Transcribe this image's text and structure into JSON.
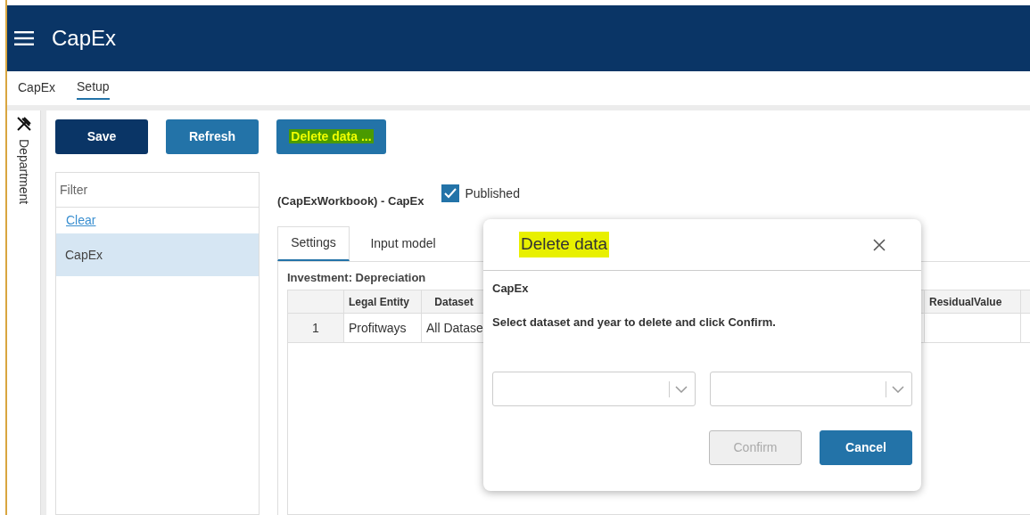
{
  "app": {
    "title": "CapEx"
  },
  "nav": [
    {
      "label": "CapEx",
      "selected": false
    },
    {
      "label": "Setup",
      "selected": true
    }
  ],
  "side_panel": {
    "label": "Department"
  },
  "toolbar": [
    {
      "label": "Save",
      "kind": "primary",
      "highlighted": false
    },
    {
      "label": "Refresh",
      "kind": "secondary",
      "highlighted": false
    },
    {
      "label": "Delete data ...",
      "kind": "secondary",
      "highlighted": true
    }
  ],
  "filter": {
    "placeholder": "Filter",
    "clear": "Clear",
    "items": [
      {
        "label": "CapEx",
        "selected": true
      }
    ]
  },
  "heading": "(CapExWorkbook) - CapEx",
  "published": {
    "label": "Published",
    "checked": true
  },
  "tabs": [
    {
      "label": "Settings",
      "selected": true
    },
    {
      "label": "Input model",
      "selected": false
    }
  ],
  "grid": {
    "title": "Investment: Depreciation",
    "columns": [
      {
        "label": "Legal Entity"
      },
      {
        "label": "Dataset"
      },
      {
        "label": "ResidualValue"
      }
    ],
    "rows": [
      {
        "number": "1",
        "cells": [
          "Profitways",
          "All Datase"
        ]
      }
    ]
  },
  "dialog": {
    "title": "Delete data",
    "title_highlighted": true,
    "subtitle": "CapEx",
    "message": "Select dataset and year to delete and click Confirm.",
    "dropdowns": [
      {
        "expanded": false
      },
      {
        "expanded": false
      }
    ],
    "buttons": [
      {
        "label": "Confirm",
        "disabled": true
      },
      {
        "label": "Cancel",
        "disabled": false
      }
    ]
  }
}
